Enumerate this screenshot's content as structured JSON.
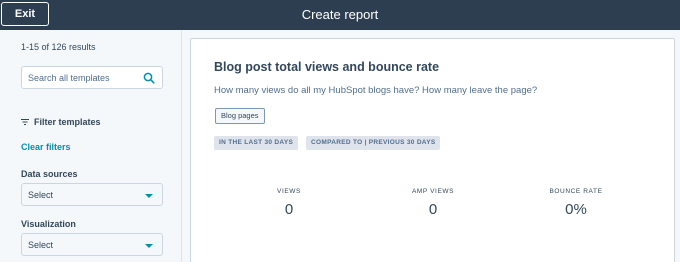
{
  "header": {
    "exit_label": "Exit",
    "title": "Create report"
  },
  "sidebar": {
    "results_text": "1-15 of 126 results",
    "search_placeholder": "Search all templates",
    "filter_label": "Filter templates",
    "clear_filters_label": "Clear filters",
    "data_sources": {
      "label": "Data sources",
      "value": "Select"
    },
    "visualization": {
      "label": "Visualization",
      "value": "Select"
    }
  },
  "card": {
    "title": "Blog post total views and bounce rate",
    "description": "How many views do all my HubSpot blogs have? How many leave the page?",
    "tag": "Blog pages",
    "pills": [
      "IN THE LAST 30 DAYS",
      "COMPARED TO | PREVIOUS 30 DAYS"
    ],
    "metrics": [
      {
        "label": "VIEWS",
        "value": "0"
      },
      {
        "label": "AMP VIEWS",
        "value": "0"
      },
      {
        "label": "BOUNCE RATE",
        "value": "0%"
      }
    ]
  },
  "colors": {
    "header_bg": "#2d3e50",
    "link": "#0091ae",
    "text": "#33475b"
  }
}
